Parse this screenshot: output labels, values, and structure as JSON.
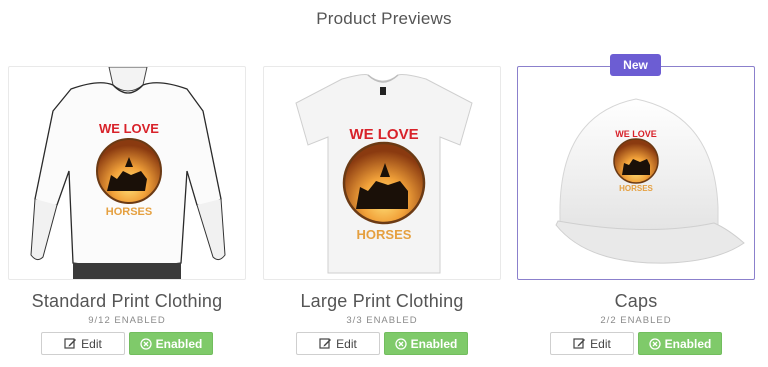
{
  "header": {
    "title": "Product Previews"
  },
  "badge": {
    "label": "New"
  },
  "print": {
    "line1": "WE LOVE",
    "line2": "HORSES"
  },
  "products": [
    {
      "name": "Standard Print Clothing",
      "count": "9/12 ENABLED",
      "edit_label": "Edit",
      "status_label": "Enabled"
    },
    {
      "name": "Large Print Clothing",
      "count": "3/3 ENABLED",
      "edit_label": "Edit",
      "status_label": "Enabled"
    },
    {
      "name": "Caps",
      "count": "2/2 ENABLED",
      "edit_label": "Edit",
      "status_label": "Enabled"
    }
  ],
  "colors": {
    "accent_purple": "#6c5dd3",
    "enabled_green": "#7fca6a",
    "print_red": "#d8222a",
    "print_orange": "#e5a040"
  },
  "icons": {
    "edit": "pencil-square-icon",
    "enabled": "circle-x-icon"
  }
}
